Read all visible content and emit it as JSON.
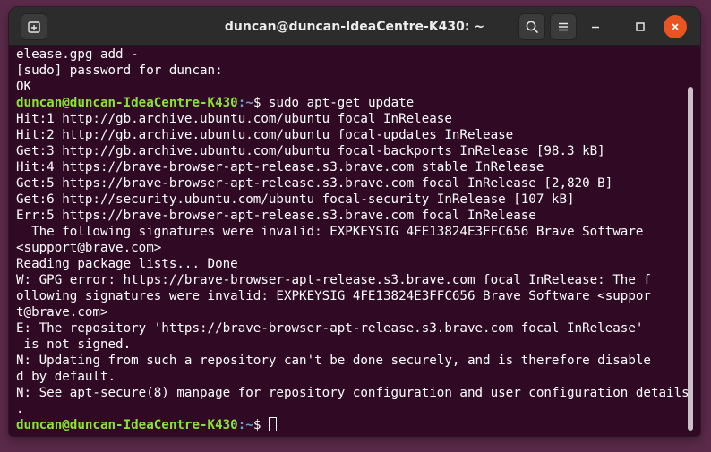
{
  "window": {
    "title": "duncan@duncan-IdeaCentre-K430: ~"
  },
  "terminal": {
    "lines": [
      "elease.gpg add -",
      "[sudo] password for duncan:",
      "OK",
      "",
      "Hit:1 http://gb.archive.ubuntu.com/ubuntu focal InRelease",
      "Hit:2 http://gb.archive.ubuntu.com/ubuntu focal-updates InRelease",
      "Get:3 http://gb.archive.ubuntu.com/ubuntu focal-backports InRelease [98.3 kB]",
      "Hit:4 https://brave-browser-apt-release.s3.brave.com stable InRelease",
      "Get:5 https://brave-browser-apt-release.s3.brave.com focal InRelease [2,820 B]",
      "Get:6 http://security.ubuntu.com/ubuntu focal-security InRelease [107 kB]",
      "Err:5 https://brave-browser-apt-release.s3.brave.com focal InRelease",
      "  The following signatures were invalid: EXPKEYSIG 4FE13824E3FFC656 Brave Software",
      "<support@brave.com>",
      "Reading package lists... Done",
      "W: GPG error: https://brave-browser-apt-release.s3.brave.com focal InRelease: The f",
      "ollowing signatures were invalid: EXPKEYSIG 4FE13824E3FFC656 Brave Software <suppor",
      "t@brave.com>",
      "E: The repository 'https://brave-browser-apt-release.s3.brave.com focal InRelease'",
      " is not signed.",
      "N: Updating from such a repository can't be done securely, and is therefore disable",
      "d by default.",
      "N: See apt-secure(8) manpage for repository configuration and user configuration details",
      "."
    ],
    "prompt1": {
      "user_host": "duncan@duncan-IdeaCentre-K430",
      "path": ":~",
      "symbol": "$ ",
      "command": "sudo apt-get update"
    },
    "prompt2": {
      "user_host": "duncan@duncan-IdeaCentre-K430",
      "path": ":~",
      "symbol": "$ "
    }
  },
  "icons": {
    "new_tab": "new-tab-icon",
    "search": "search-icon",
    "menu": "hamburger-menu-icon",
    "minimize": "minimize-icon",
    "maximize": "maximize-icon",
    "close": "close-icon"
  },
  "colors": {
    "terminal_bg": "#300a24",
    "prompt_user": "#8ae234",
    "prompt_path": "#729fcf",
    "close_button": "#e95420",
    "titlebar": "#2c2c2c"
  }
}
